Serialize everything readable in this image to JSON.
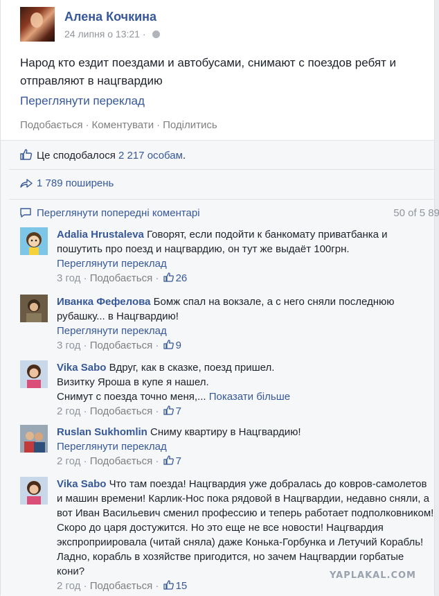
{
  "post": {
    "author": "Алена Кочкина",
    "timestamp": "24 липня о 13:21 · ",
    "privacy_icon": "globe-icon",
    "text": "Народ кто ездит поездами и автобусами, снимают с поездов ребят и отправляют в нацгвардию",
    "translate_link": "Переглянути переклад",
    "actions": [
      "Подобається",
      "Коментувати",
      "Поділитись"
    ]
  },
  "feedback": {
    "likes_prefix": "Це сподобалося ",
    "likes_count": "2 217 особам",
    "likes_suffix": ".",
    "shares": "1 789 поширень",
    "prev_comments_link": "Переглянути попередні коментарі",
    "comment_counter": "50 of 5 89"
  },
  "comments": [
    {
      "author": "Adalia Hrustaleva",
      "text": "Говорят, если подойти к банкомату приватбанка и пошутить про поезд и нацгвардию, он тут же выдаёт 100грн.",
      "translate": "Переглянути переклад",
      "time": "3 год",
      "like": "Подобається",
      "likes": "26"
    },
    {
      "author": "Иванка Фефелова",
      "text": "Бомж спал на вокзале, а с него сняли последнюю рубашку... в Нацгвардию!",
      "translate": "Переглянути переклад",
      "time": "3 год",
      "like": "Подобається",
      "likes": "9"
    },
    {
      "author": "Vika Sabo",
      "text": "Вдруг, как в сказке, поезд пришел.",
      "text2": "Визитку Яроша в купе я нашел.",
      "text3": "Снимут с поезда точно меня,...",
      "show_more": "Показати більше",
      "time": "2 год",
      "like": "Подобається",
      "likes": "7"
    },
    {
      "author": "Ruslan Sukhomlin",
      "text": "Сниму квартиру в Нацгвардию!",
      "translate": "Переглянути переклад",
      "time": "2 год",
      "like": "Подобається",
      "likes": "7"
    },
    {
      "author": "Vika Sabo",
      "text": "Что там поезда! Нацгвардия уже добралась до ковров-самолетов и машин времени! Карлик-Нос пока рядовой в Нацгвардии, недавно сняли, а вот Иван Васильевич сменил профессию и теперь работает подполковником! Скоро до царя достужится. Но это еще не все новости! Нацгвардия экспроприировала (читай сняла) даже Конька-Горбунка и Летучий Корабль! Ладно, корабль в хозяйстве пригодится, но зачем Нацгвардии горбатые кони?",
      "time": "2 год",
      "like": "Подобається",
      "likes": "15"
    }
  ],
  "watermark": "YAPLAKAL.COM",
  "colors": {
    "link": "#365899",
    "meta": "#90949c",
    "feedback_bg": "#f6f7f9"
  }
}
